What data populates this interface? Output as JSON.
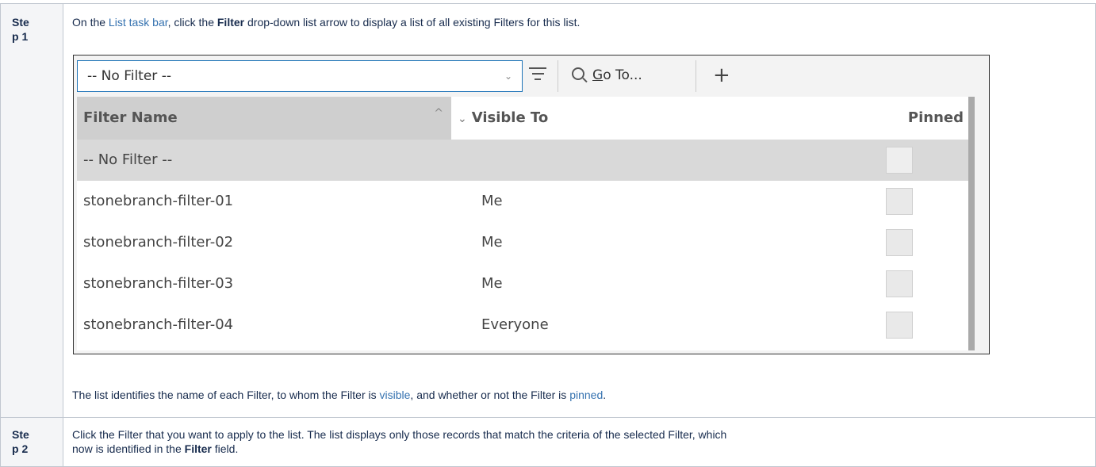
{
  "steps": [
    {
      "label_line1": "Ste",
      "label_line2": "p 1",
      "intro": {
        "before": "On the ",
        "link": "List task bar",
        "middle": ", click the ",
        "bold": "Filter",
        "after": " drop-down list arrow to display a list of all existing Filters for this list."
      },
      "outro": {
        "part1": "The list identifies the name of each Filter, to whom the Filter is ",
        "link1": "visible",
        "part2": ", and whether or not the Filter is ",
        "link2": "pinned",
        "part3": "."
      }
    },
    {
      "label_line1": "Ste",
      "label_line2": "p 2",
      "line1": "Click the Filter that you want to apply to the list. The list displays only those records that match the criteria of the selected Filter, which",
      "line2_before": "now is identified in the ",
      "line2_bold": "Filter",
      "line2_after": " field."
    }
  ],
  "screenshot": {
    "select_value": "-- No Filter --",
    "select_arrow": "⌄",
    "goto_underlined": "G",
    "goto_rest": "o To...",
    "add_symbol": "+",
    "columns": {
      "name": "Filter Name",
      "name_caret": "^",
      "visible_chevron": "⌄",
      "visible": "Visible To",
      "pinned": "Pinned"
    },
    "rows": [
      {
        "name": "-- No Filter --",
        "visible": "",
        "selected": true
      },
      {
        "name": "stonebranch-filter-01",
        "visible": "Me",
        "selected": false
      },
      {
        "name": "stonebranch-filter-02",
        "visible": "Me",
        "selected": false
      },
      {
        "name": "stonebranch-filter-03",
        "visible": "Me",
        "selected": false
      },
      {
        "name": "stonebranch-filter-04",
        "visible": "Everyone",
        "selected": false
      }
    ]
  },
  "colors": {
    "link": "#3572b0",
    "select_border": "#1f74b8",
    "selected_row": "#d9d9d9",
    "header_sorted": "#cfcfcf"
  }
}
